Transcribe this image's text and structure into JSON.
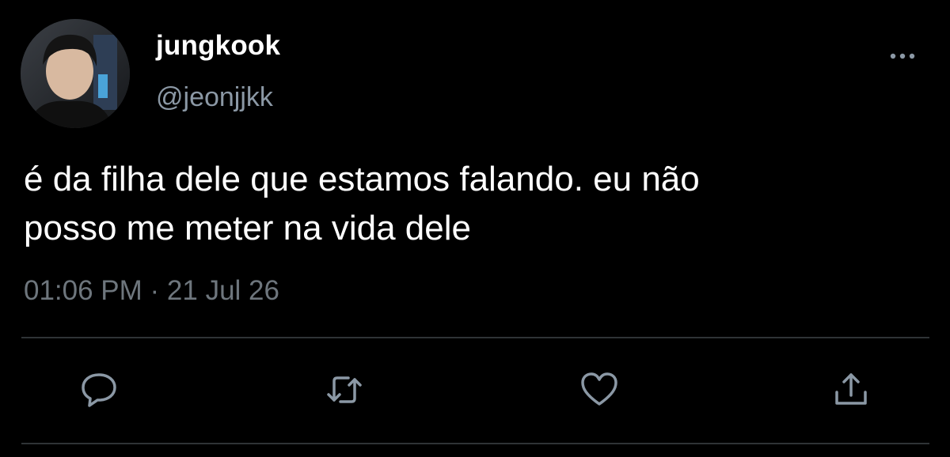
{
  "tweet": {
    "author": {
      "display_name": "jungkook",
      "handle": "@jeonjjkk"
    },
    "text_lines": [
      "é da filha dele que estamos falando. eu não",
      "posso me meter na vida dele"
    ],
    "timestamp": "01:06 PM · 21 Jul 26"
  },
  "icons": {
    "more": "more-dots-icon",
    "reply": "reply-bubble-icon",
    "retweet": "retweet-arrows-icon",
    "like": "heart-icon",
    "share": "share-upload-icon"
  },
  "colors": {
    "background": "#000000",
    "primary_text": "#ffffff",
    "secondary_text": "#8b98a5",
    "timestamp_text": "#6e767d",
    "icon": "#8b98a5",
    "divider": "#2f3336"
  }
}
